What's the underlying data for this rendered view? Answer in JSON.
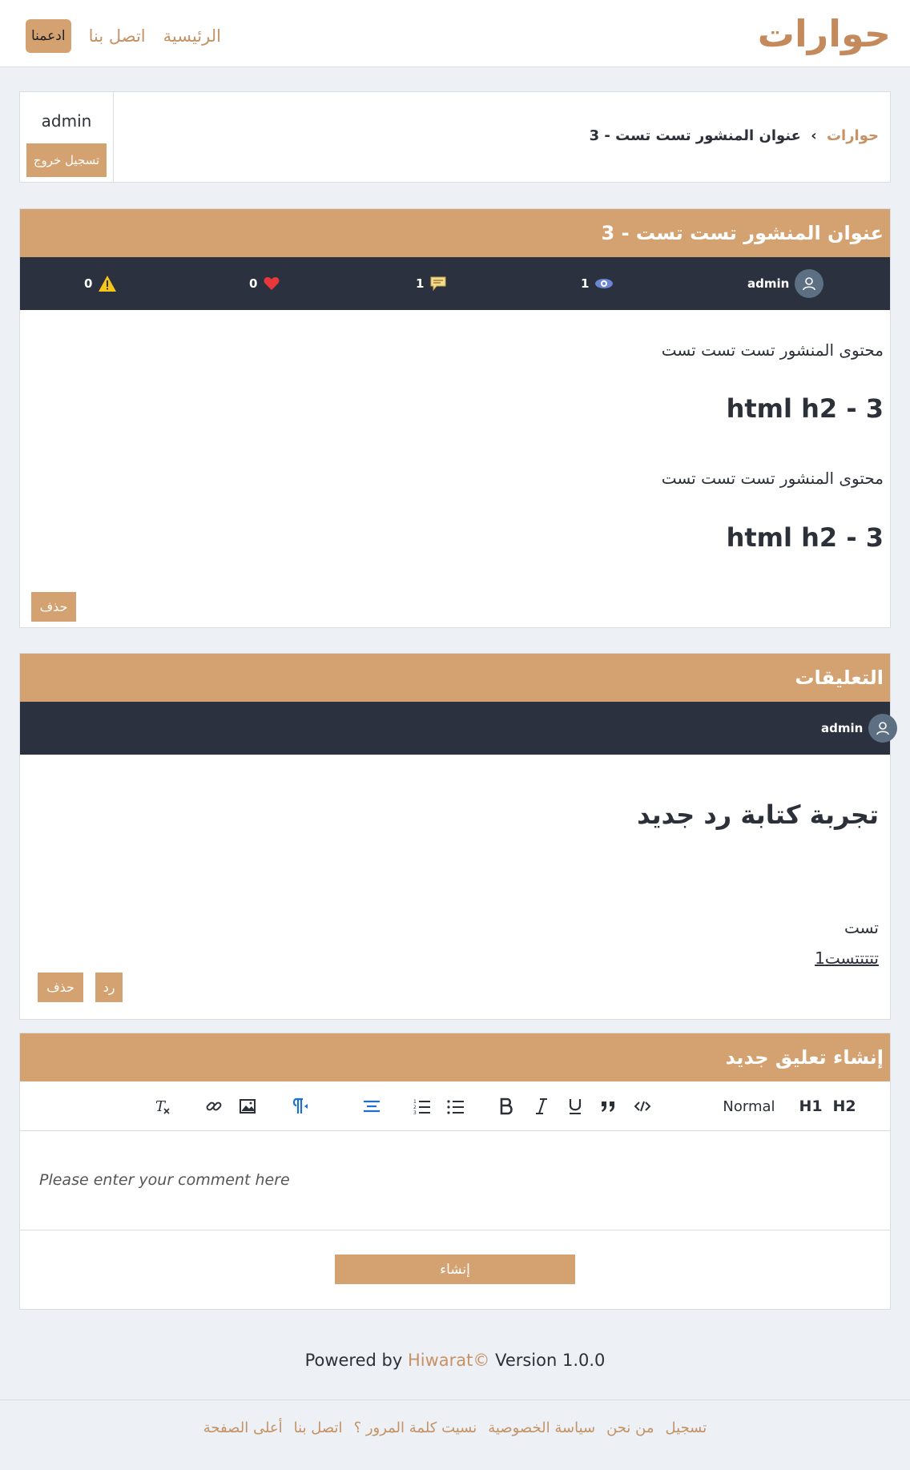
{
  "header": {
    "logo_text": "حوارات",
    "nav": {
      "home": "الرئيسية",
      "contact": "اتصل بنا",
      "support": "ادعمنا"
    }
  },
  "breadcrumb": {
    "home": "حوارات",
    "separator": "›",
    "current": "عنوان المنشور تست تست - 3"
  },
  "user_panel": {
    "username": "admin",
    "logout_label": "تسجيل خروج"
  },
  "post": {
    "title": "عنوان المنشور تست تست - 3",
    "author": "admin",
    "views": "1",
    "comments": "1",
    "likes": "0",
    "reports": "0",
    "content_paragraph_1": "محتوى المنشور تست تست تست",
    "content_heading_1": "html h2 - 3",
    "content_paragraph_2": "محتوى المنشور تست تست تست",
    "content_heading_2": "html h2 - 3",
    "delete_label": "حذف"
  },
  "comments": {
    "section_title": "التعليقات",
    "items": [
      {
        "author": "admin",
        "heading": "تجربة كتابة رد جديد",
        "line_1": "تست",
        "line_2": "تتتتتست1",
        "reply_label": "رد",
        "delete_label": "حذف"
      }
    ]
  },
  "new_comment": {
    "section_title": "إنشاء تعليق جديد",
    "toolbar": {
      "heading_1": "H1",
      "heading_2": "H2",
      "normal": "Normal"
    },
    "placeholder": "Please enter your comment here",
    "submit_label": "إنشاء"
  },
  "powered_by": {
    "prefix": "Powered by",
    "brand": "Hiwarat©",
    "version": "Version 1.0.0"
  },
  "footer": {
    "links": [
      "تسجيل",
      "من نحن",
      "سياسة الخصوصية",
      "نسيت كلمة المرور ؟",
      "اتصل بنا",
      "أعلى الصفحة"
    ]
  },
  "colors": {
    "accent": "#d4a270",
    "dark_bar": "#2b313e",
    "link": "#c89164",
    "background": "#edf0f5"
  }
}
